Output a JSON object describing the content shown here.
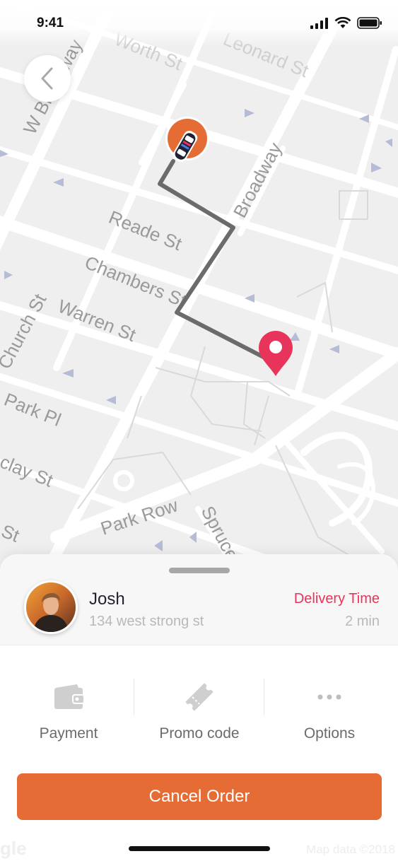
{
  "status_bar": {
    "time": "9:41"
  },
  "map": {
    "streets": [
      "Worth St",
      "Leonard St",
      "W Broadway",
      "Broadway",
      "Reade St",
      "Chambers St",
      "Church St",
      "Warren St",
      "Park Pl",
      "clay St",
      "Park Row",
      "Spruce",
      "St"
    ],
    "attribution": "Map data ©2018",
    "logo_fragment": "gle",
    "route_color": "#6b6b6b",
    "driver_marker_color": "#e56d35",
    "destination_pin_color": "#e8345a"
  },
  "back_button": {
    "icon": "chevron-left-icon"
  },
  "sheet": {
    "driver": {
      "name": "Josh",
      "address": "134 west strong st",
      "delivery_label": "Delivery Time",
      "delivery_value": "2 min"
    },
    "actions": [
      {
        "label": "Payment",
        "icon": "wallet-icon"
      },
      {
        "label": "Promo code",
        "icon": "ticket-icon"
      },
      {
        "label": "Options",
        "icon": "more-dots-icon"
      }
    ],
    "cancel_label": "Cancel Order",
    "accent_color": "#e56d35",
    "alert_color": "#e8345a"
  }
}
